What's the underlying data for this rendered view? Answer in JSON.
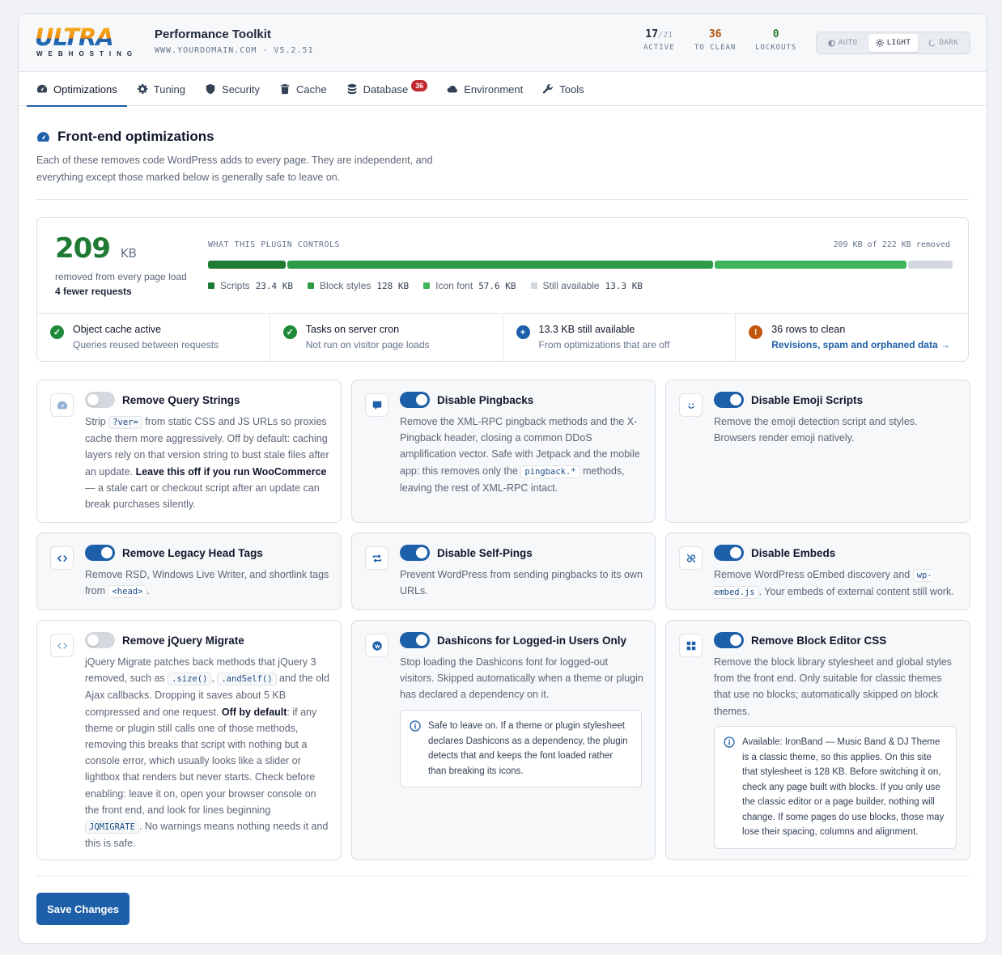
{
  "header": {
    "logo_word": "ULTRA",
    "logo_sub": "WEBHOSTING",
    "title": "Performance Toolkit",
    "subtitle": "WWW.YOURDOMAIN.COM · V5.2.51",
    "stats": [
      {
        "value": "17",
        "suffix": "/21",
        "label": "ACTIVE",
        "color": "#0f172a"
      },
      {
        "value": "36",
        "suffix": "",
        "label": "TO CLEAN",
        "color": "#b45309"
      },
      {
        "value": "0",
        "suffix": "",
        "label": "LOCKOUTS",
        "color": "#1f7a34"
      }
    ],
    "theme": {
      "auto": "AUTO",
      "light": "LIGHT",
      "dark": "DARK",
      "selected": "light"
    }
  },
  "tabs": [
    {
      "label": "Optimizations",
      "icon": "gauge-icon",
      "active": true
    },
    {
      "label": "Tuning",
      "icon": "gear-icon"
    },
    {
      "label": "Security",
      "icon": "shield-icon"
    },
    {
      "label": "Cache",
      "icon": "trash-icon"
    },
    {
      "label": "Database",
      "icon": "database-icon",
      "badge": "36"
    },
    {
      "label": "Environment",
      "icon": "cloud-icon"
    },
    {
      "label": "Tools",
      "icon": "wrench-icon"
    }
  ],
  "section": {
    "title": "Front-end optimizations",
    "description": "Each of these removes code WordPress adds to every page. They are independent, and everything except those marked below is generally safe to leave on."
  },
  "summary": {
    "amount": "209",
    "unit": "KB",
    "removed_label": "removed from every page load",
    "requests": "4 fewer requests",
    "controls_label": "WHAT THIS PLUGIN CONTROLS",
    "controls_total": "209 KB of 222 KB removed",
    "segments": [
      {
        "name": "Scripts",
        "value": "23.4 KB",
        "kb": 23.4,
        "color": "#1f7a34"
      },
      {
        "name": "Block styles",
        "value": "128 KB",
        "kb": 128,
        "color": "#2f9a47"
      },
      {
        "name": "Icon font",
        "value": "57.6 KB",
        "kb": 57.6,
        "color": "#3fb55a"
      },
      {
        "name": "Still available",
        "value": "13.3 KB",
        "kb": 13.3,
        "color": "#d3d8de"
      }
    ],
    "status": [
      {
        "title": "Object cache active",
        "sub": "Queries reused between requests",
        "icon": "check-icon",
        "color": "#1f8a3a",
        "glyph": "✓"
      },
      {
        "title": "Tasks on server cron",
        "sub": "Not run on visitor page loads",
        "icon": "check-icon",
        "color": "#1f8a3a",
        "glyph": "✓"
      },
      {
        "title": "13.3 KB still available",
        "sub": "From optimizations that are off",
        "icon": "plus-icon",
        "color": "#1d5fa8",
        "glyph": "+"
      },
      {
        "title": "36 rows to clean",
        "sub": "Revisions, spam and orphaned data →",
        "icon": "warning-icon",
        "color": "#c2560c",
        "glyph": "!",
        "link": true
      }
    ]
  },
  "cards": {
    "c1": {
      "title": "Remove Query Strings",
      "on": false,
      "t1": "Strip ",
      "code1": "?ver=",
      "t2": " from static CSS and JS URLs so proxies cache them more aggressively. Off by default: caching layers rely on that version string to bust stale files after an update. ",
      "bold1": "Leave this off if you run WooCommerce",
      "t3": " — a stale cart or checkout script after an update can break purchases silently."
    },
    "c2": {
      "title": "Disable Pingbacks",
      "on": true,
      "t1": "Remove the XML-RPC pingback methods and the X-Pingback header, closing a common DDoS amplification vector. Safe with Jetpack and the mobile app: this removes only the ",
      "code1": "pingback.*",
      "t2": " methods, leaving the rest of XML-RPC intact."
    },
    "c3": {
      "title": "Disable Emoji Scripts",
      "on": true,
      "t1": "Remove the emoji detection script and styles. Browsers render emoji natively."
    },
    "c4": {
      "title": "Remove Legacy Head Tags",
      "on": true,
      "t1": "Remove RSD, Windows Live Writer, and shortlink tags from ",
      "code1": "<head>",
      "t2": "."
    },
    "c5": {
      "title": "Disable Self-Pings",
      "on": true,
      "t1": "Prevent WordPress from sending pingbacks to its own URLs."
    },
    "c6": {
      "title": "Disable Embeds",
      "on": true,
      "t1": "Remove WordPress oEmbed discovery and ",
      "code1": "wp-embed.js",
      "t2": ". Your embeds of external content still work."
    },
    "c7": {
      "title": "Remove jQuery Migrate",
      "on": false,
      "t1": "jQuery Migrate patches back methods that jQuery 3 removed, such as ",
      "code1": ".size()",
      "sep": ", ",
      "code2": ".andSelf()",
      "t2": " and the old Ajax callbacks. Dropping it saves about 5 KB compressed and one request. ",
      "bold1": "Off by default",
      "t3": ": if any theme or plugin still calls one of those methods, removing this breaks that script with nothing but a console error, which usually looks like a slider or lightbox that renders but never starts. Check before enabling: leave it on, open your browser console on the front end, and look for lines beginning ",
      "code3": "JQMIGRATE",
      "t4": ". No warnings means nothing needs it and this is safe."
    },
    "c8": {
      "title": "Dashicons for Logged-in Users Only",
      "on": true,
      "t1": "Stop loading the Dashicons font for logged-out visitors. Skipped automatically when a theme or plugin has declared a dependency on it.",
      "note": "Safe to leave on. If a theme or plugin stylesheet declares Dashicons as a dependency, the plugin detects that and keeps the font loaded rather than breaking its icons."
    },
    "c9": {
      "title": "Remove Block Editor CSS",
      "on": true,
      "t1": "Remove the block library stylesheet and global styles from the front end. Only suitable for classic themes that use no blocks; automatically skipped on block themes.",
      "note": "Available: IronBand — Music Band & DJ Theme is a classic theme, so this applies. On this site that stylesheet is 128 KB. Before switching it on, check any page built with blocks. If you only use the classic editor or a page builder, nothing will change. If some pages do use blocks, those may lose their spacing, columns and alignment."
    }
  },
  "save_label": "Save Changes"
}
